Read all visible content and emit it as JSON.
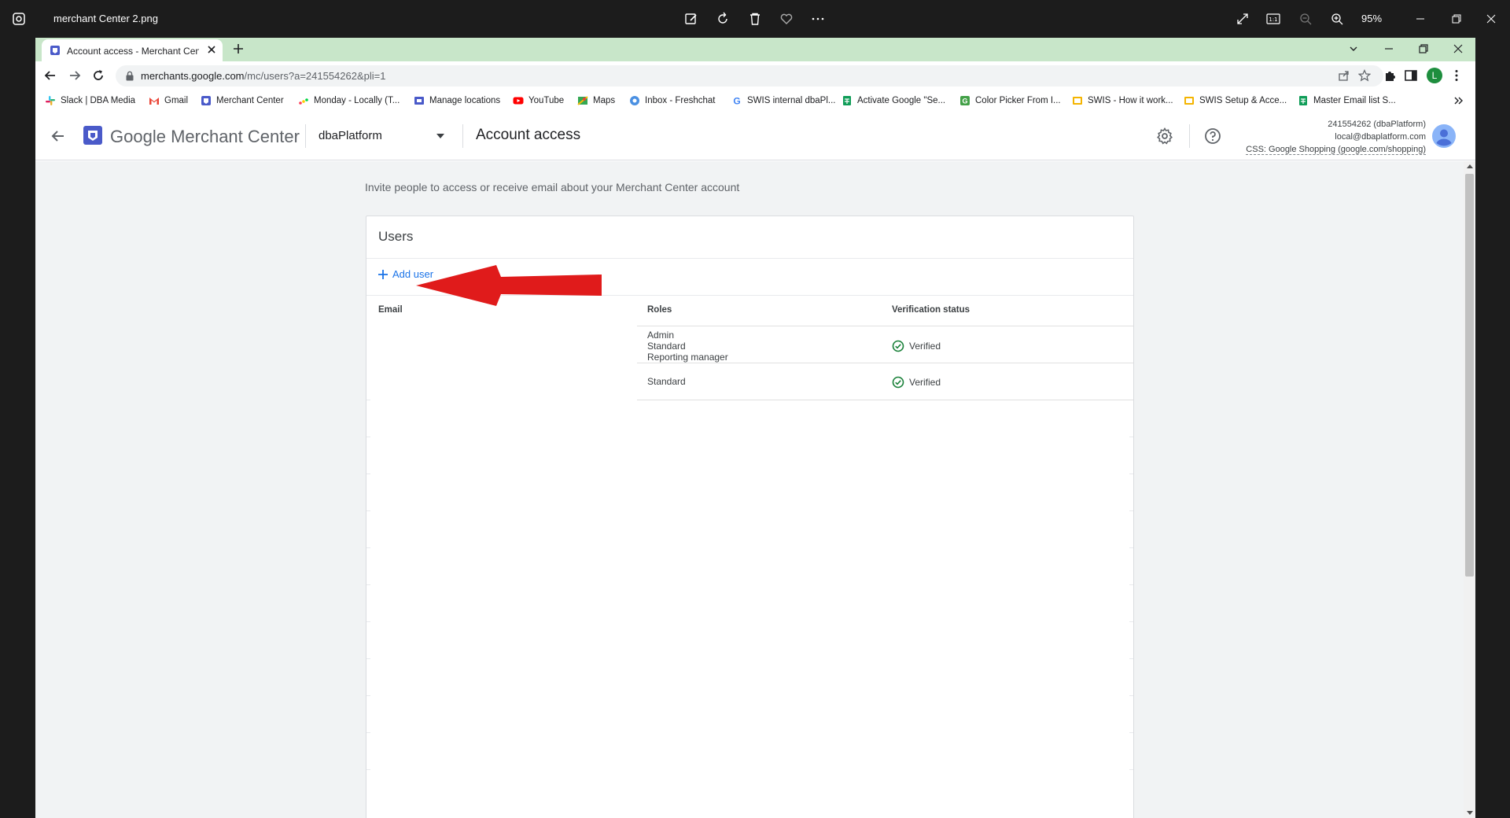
{
  "viewer": {
    "file_name": "merchant Center 2.png",
    "zoom": "95%"
  },
  "browser": {
    "tab_title": "Account access - Merchant Center",
    "url_domain": "merchants.google.com",
    "url_path": "/mc/users?a=241554262&pli=1",
    "profile_initial": "L",
    "bookmarks": [
      "Slack | DBA Media",
      "Gmail",
      "Merchant Center",
      "Monday - Locally (T...",
      "Manage locations",
      "YouTube",
      "Maps",
      "Inbox - Freshchat",
      "SWIS internal dbaPl...",
      "Activate Google \"Se...",
      "Color Picker From I...",
      "SWIS - How it work...",
      "SWIS Setup & Acce...",
      "Master Email list S..."
    ]
  },
  "app": {
    "brand_google": "Google",
    "brand_product": "Merchant Center",
    "account_name": "dbaPlatform",
    "page_title": "Account access",
    "account_id_line": "241554262 (dbaPlatform)",
    "account_email": "local@dbaplatform.com",
    "css_line": "CSS: Google Shopping (google.com/shopping)"
  },
  "main": {
    "intro": "Invite people to access or receive email about your Merchant Center account",
    "card_title": "Users",
    "add_user_label": "Add user",
    "columns": {
      "email": "Email",
      "roles": "Roles",
      "verification": "Verification status"
    },
    "rows": [
      {
        "roles": [
          "Admin",
          "Standard",
          "Reporting manager"
        ],
        "status": "Verified"
      },
      {
        "roles": [
          "Standard"
        ],
        "status": "Verified"
      }
    ]
  },
  "colors": {
    "accent": "#1a73e8",
    "verified": "#188038",
    "annotation_arrow": "#e01b1b",
    "tabstrip": "#c8e6c9"
  }
}
